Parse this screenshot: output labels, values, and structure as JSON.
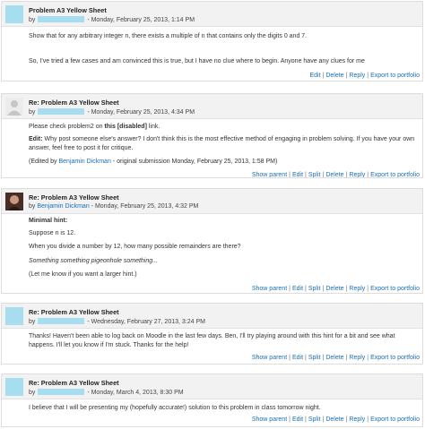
{
  "posts": [
    {
      "title": "Problem A3 Yellow Sheet",
      "by": "by",
      "date": "- Monday, February 25, 2013, 1:14 PM",
      "body1": "Show that for any arbitrary integer n, there exists a multiple of n that contains only the digits 0 and 7.",
      "body2": "So, I've tried a few cases and am convinced this is true, but I have no clue where to begin. Anyone have any clues for me",
      "cmds": [
        "Edit",
        "Delete",
        "Reply",
        "Export to portfolio"
      ]
    },
    {
      "title": "Re: Problem A3 Yellow Sheet",
      "by": "by",
      "date": "- Monday, February 25, 2013, 4:34 PM",
      "body1_pre": "Please check problem2 on",
      "body1_bold": "this [disabled]",
      "body1_post": "link.",
      "edit_label": "Edit:",
      "edit_text": "Why post someone else's answer? I don't think this is the most effective method of engaging in problem solving. If you have your own answer, feel free to post it for critique.",
      "edited_pre": "(Edited by",
      "edited_name": "Benjamin Dickman",
      "edited_post": "- original submission Monday, February 25, 2013, 1:58 PM)",
      "cmds": [
        "Show parent",
        "Edit",
        "Split",
        "Delete",
        "Reply",
        "Export to portfolio"
      ]
    },
    {
      "title": "Re: Problem A3 Yellow Sheet",
      "by": "by",
      "author": "Benjamin Dickman",
      "date": "- Monday, February 25, 2013, 4:32 PM",
      "hint": "Minimal hint:",
      "l1": "Suppose n is 12.",
      "l2": "When you divide a number by 12, how many possible remainders are there?",
      "l3": "Something something pigeonhole something...",
      "l4": "(Let me know if you want a larger hint.)",
      "cmds": [
        "Show parent",
        "Edit",
        "Split",
        "Delete",
        "Reply",
        "Export to portfolio"
      ]
    },
    {
      "title": "Re: Problem A3 Yellow Sheet",
      "by": "by",
      "date": "- Wednesday, February 27, 2013, 3:24 PM",
      "body1": "Thanks! Haven't been able to log back on Moodle in the last few days. Ben, I'll try playing around with this hint for a bit and see what happens. I'll let you know if I'm stuck. Thanks for the help!",
      "cmds": [
        "Show parent",
        "Edit",
        "Split",
        "Delete",
        "Reply",
        "Export to portfolio"
      ]
    },
    {
      "title": "Re: Problem A3 Yellow Sheet",
      "by": "by",
      "date": "- Monday, March 4, 2013, 8:30 PM",
      "body1": "I believe that I will be presenting my (hopefully accurate!) solution to this problem in class tomorrow night.",
      "cmds": [
        "Show parent",
        "Edit",
        "Split",
        "Delete",
        "Reply",
        "Export to portfolio"
      ]
    }
  ]
}
